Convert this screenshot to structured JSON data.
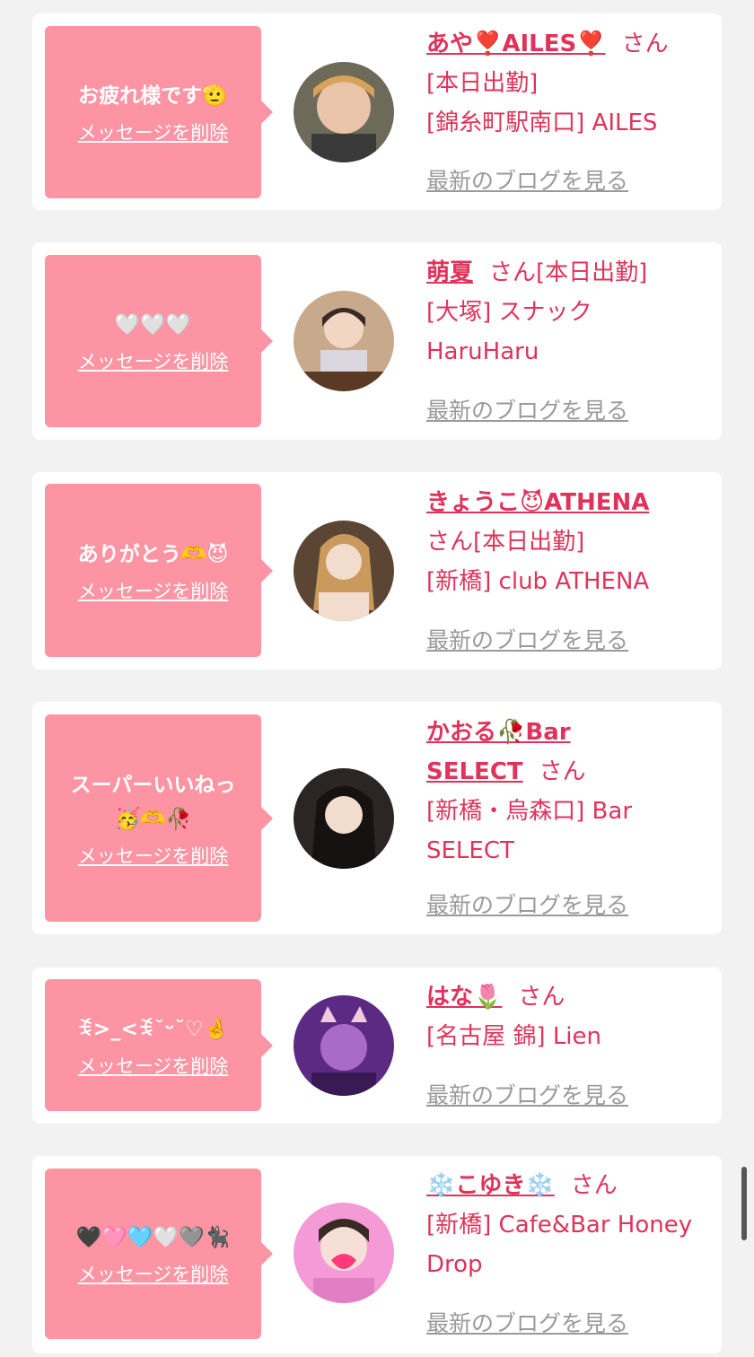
{
  "delete_label": "メッセージを削除",
  "blog_label": "最新のブログを見る",
  "san_label": "さん",
  "colors": {
    "accent": "#e0335b",
    "bubble": "#fd94a4",
    "muted": "#9a9a9a",
    "background": "#f2f2f3"
  },
  "cards": [
    {
      "message": "お疲れ様です🫡",
      "name": "あや❣️AILES❣️",
      "info_lines": [
        "[本日出勤]",
        "[錦糸町駅南口] AILES"
      ]
    },
    {
      "message": "🤍🤍🤍",
      "name": "萌夏",
      "info_lines": [
        "[本日出勤]",
        "[大塚] スナック HaruHaru"
      ]
    },
    {
      "message": "ありがとう🫶😈",
      "name": "きょうこ😈ATHENA",
      "info_lines": [
        "[本日出勤]",
        "[新橋] club ATHENA"
      ]
    },
    {
      "message_lines": [
        "スーパーいいねっ",
        "🥳🫶🥀"
      ],
      "name_lines": [
        "かおる🥀Bar",
        "SELECT"
      ],
      "info_lines": [
        "[新橋・烏森口] Bar SELECT"
      ]
    },
    {
      "message": "ꉂ>_<ꉂ˘ᵕ˘♡🤞",
      "name": "はな🌷",
      "info_lines": [
        "[名古屋 錦] Lien"
      ]
    },
    {
      "message": "🖤🩷🩵🤍🩶🐈‍⬛",
      "name": "❄️こゆき❄️",
      "info_lines": [
        "[新橋] Cafe&Bar Honey Drop"
      ]
    }
  ]
}
